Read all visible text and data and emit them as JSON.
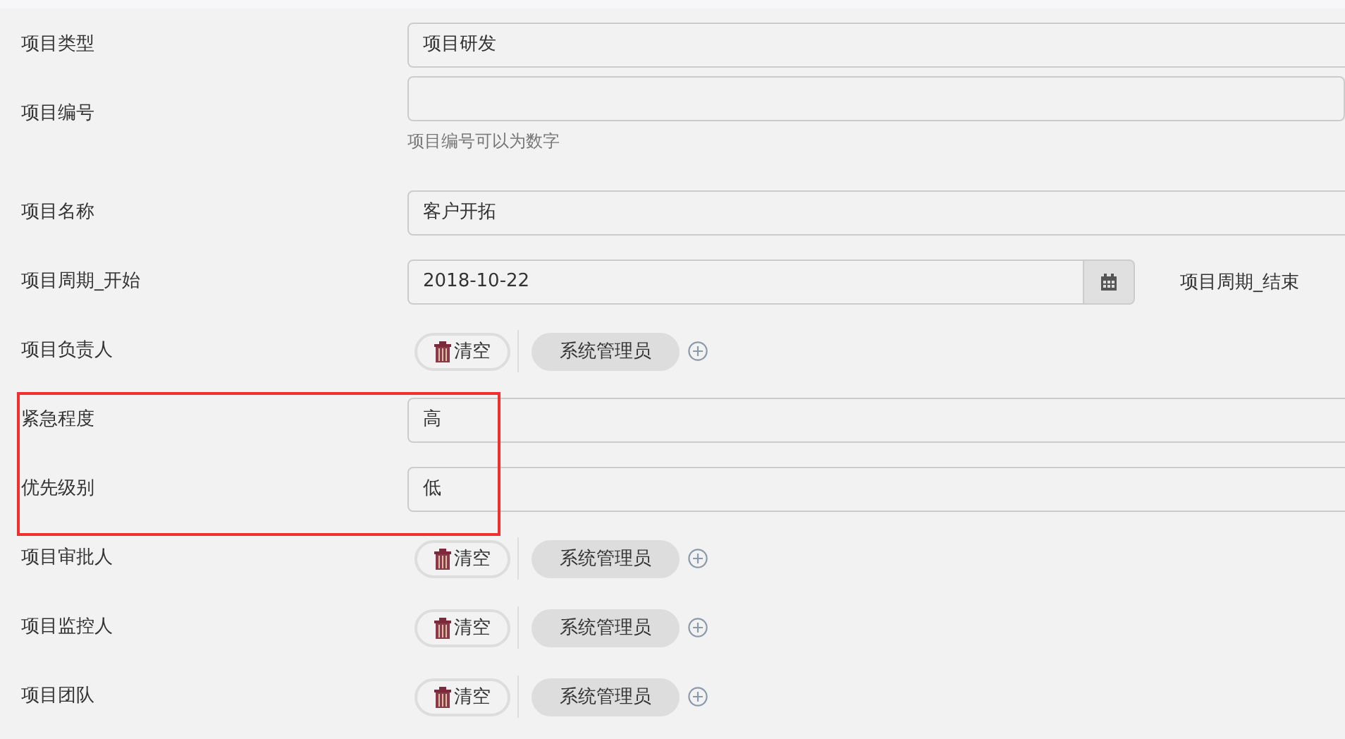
{
  "form": {
    "rows": [
      {
        "kind": "text",
        "label": "项目类型",
        "value": "项目研发",
        "highlighted": false
      },
      {
        "kind": "text",
        "label": "项目编号",
        "hint": "项目编号可以为数字",
        "highlighted": false
      },
      {
        "kind": "text",
        "label": "项目名称",
        "value": "客户开拓",
        "highlighted": false
      },
      {
        "kind": "date",
        "label": "项目周期_开始",
        "value": "2018-10-22",
        "side_label": "项目周期_结束",
        "highlighted": false
      },
      {
        "kind": "people",
        "label": "项目负责人",
        "clear": "清空",
        "people": [
          "系统管理员"
        ],
        "highlighted": false
      },
      {
        "kind": "text",
        "label": "紧急程度",
        "value": "高",
        "highlighted": true
      },
      {
        "kind": "text",
        "label": "优先级别",
        "value": "低",
        "highlighted": true
      },
      {
        "kind": "people",
        "label": "项目审批人",
        "clear": "清空",
        "people": [
          "系统管理员"
        ],
        "highlighted": false
      },
      {
        "kind": "people",
        "label": "项目监控人",
        "clear": "清空",
        "people": [
          "系统管理员"
        ],
        "highlighted": false
      },
      {
        "kind": "people",
        "label": "项目团队",
        "clear": "清空",
        "people": [
          "系统管理员"
        ],
        "highlighted": false
      }
    ]
  }
}
